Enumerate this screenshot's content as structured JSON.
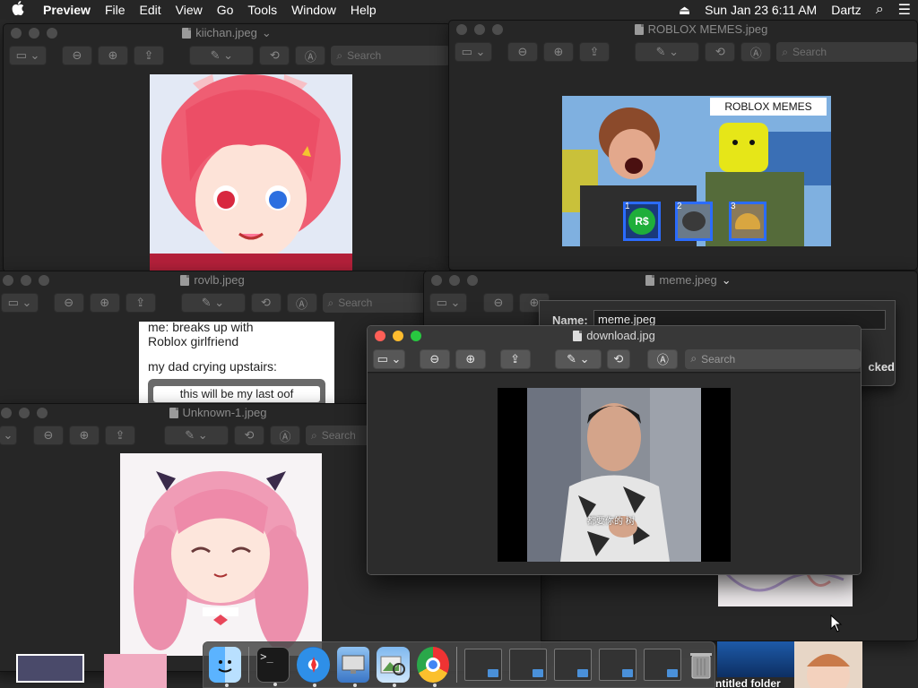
{
  "menubar": {
    "app_name": "Preview",
    "items": [
      "File",
      "Edit",
      "View",
      "Go",
      "Tools",
      "Window",
      "Help"
    ],
    "eject_glyph": "⏏",
    "clock": "Sun Jan 23  6:11 AM",
    "user": "Dartz",
    "search_glyph": "⌕",
    "list_glyph": "☰"
  },
  "windows": {
    "kiichan": {
      "title": "kiichan.jpeg",
      "search_placeholder": "Search"
    },
    "roblox": {
      "title": "ROBLOX MEMES.jpeg",
      "search_placeholder": "Search",
      "image_caption": "ROBLOX MEMES",
      "badges": [
        "1",
        "2",
        "3"
      ],
      "badge_1_text": "R$"
    },
    "rovlb": {
      "title": "rovlb.jpeg",
      "search_placeholder": "Search",
      "line1": "me: breaks up with",
      "line2": "Roblox girlfriend",
      "line3": "my dad crying upstairs:",
      "line4": "this will be my last oof"
    },
    "meme": {
      "title": "meme.jpeg",
      "name_label": "Name:",
      "name_value": "meme.jpeg",
      "locked_text": "cked"
    },
    "unknown": {
      "title": "Unknown-1.jpeg",
      "search_placeholder": "Search"
    },
    "download": {
      "title": "download.jpg",
      "search_placeholder": "Search",
      "subtitle_text": "都要你的 树"
    }
  },
  "desktop": {
    "folder_label": "ntitled folder"
  },
  "dock": {
    "apps": [
      "Finder",
      "Terminal",
      "Safari",
      "System Preferences",
      "Preview",
      "Google Chrome"
    ],
    "minimized_count": 5,
    "trash": "Trash"
  },
  "colors": {
    "accent": "#0a84ff",
    "close": "#ff5f57",
    "minimize": "#febc2e",
    "zoom": "#28c840"
  }
}
